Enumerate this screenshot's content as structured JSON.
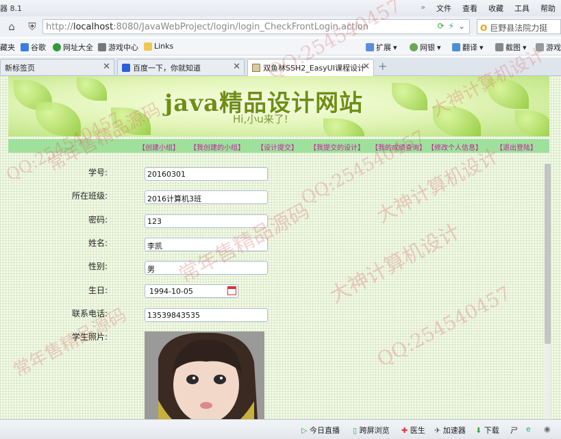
{
  "browser": {
    "app_title": "器 8.1",
    "menu": [
      "文件",
      "查看",
      "收藏",
      "工具",
      "帮助"
    ],
    "url_scheme": "http://",
    "url_host": "localhost",
    "url_rest": ":8080/JavaWebProject/login/login_CheckFrontLogin.action",
    "search_text": "巨野县法院力挺",
    "favorites": [
      "藏夹",
      "谷歌",
      "网址大全",
      "游戏中心",
      "Links"
    ],
    "toolbar_right": [
      "扩展",
      "网银",
      "翻译",
      "截图",
      "游戏"
    ],
    "tabs": [
      {
        "label": "新标签页",
        "active": false
      },
      {
        "label": "百度一下，你就知道",
        "active": false
      },
      {
        "label": "双鱼林SSH2_EasyUI课程设计",
        "active": true
      }
    ],
    "status_items": [
      "今日直播",
      "跨屏浏览",
      "医生",
      "加速器",
      "下载"
    ]
  },
  "site": {
    "title": "java精品设计网站",
    "subtitle": "Hi,小u来了!",
    "nav": [
      "【创建小组】",
      "【我创建的小组】",
      "【设计提交】",
      "【我提交的设计】",
      "【我的成绩查询】",
      "【修改个人信息】",
      "【退出登陆】"
    ]
  },
  "form": {
    "student_id_label": "学号:",
    "student_id": "20160301",
    "class_label": "所在班级:",
    "class_value": "2016计算机3班",
    "password_label": "密码:",
    "password": "123",
    "name_label": "姓名:",
    "name": "李凯",
    "gender_label": "性别:",
    "gender": "男",
    "birthday_label": "生日:",
    "birthday": "1994-10-05",
    "phone_label": "联系电话:",
    "phone": "13539843535",
    "photo_label": "学生照片:"
  },
  "watermarks": [
    "QQ:254540457",
    "常年售精品源码",
    "大神计算机设计",
    "QQ:254540457",
    "常年售精品源码",
    "QQ:254540457",
    "大神计算机设计",
    "QQ:254540457",
    "常年售精品源码",
    "大神计算机设计"
  ]
}
